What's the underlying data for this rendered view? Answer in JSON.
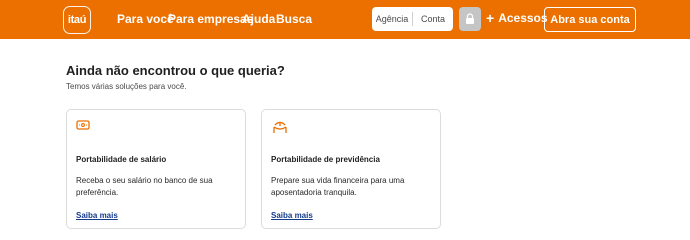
{
  "header": {
    "logo_text": "itaú",
    "nav": [
      "Para você",
      "Para empresas",
      "Ajuda",
      "Busca"
    ],
    "account": {
      "agencia_placeholder": "Agência",
      "conta_placeholder": "Conta"
    },
    "acessos_label": "Acessos",
    "open_account_label": "Abra sua conta",
    "accent_color": "#ec7000"
  },
  "main": {
    "title": "Ainda não encontrou o que queria?",
    "subtitle": "Temos várias soluções para você.",
    "cards": [
      {
        "icon": "salary-card-icon",
        "title": "Portabilidade de salário",
        "description": "Receba o seu salário no banco de sua preferência.",
        "link": "Saiba mais"
      },
      {
        "icon": "hammock-icon",
        "title": "Portabilidade de previdência",
        "description": "Prepare sua vida financeira para uma aposentadoria tranquila.",
        "link": "Saiba mais"
      }
    ]
  }
}
